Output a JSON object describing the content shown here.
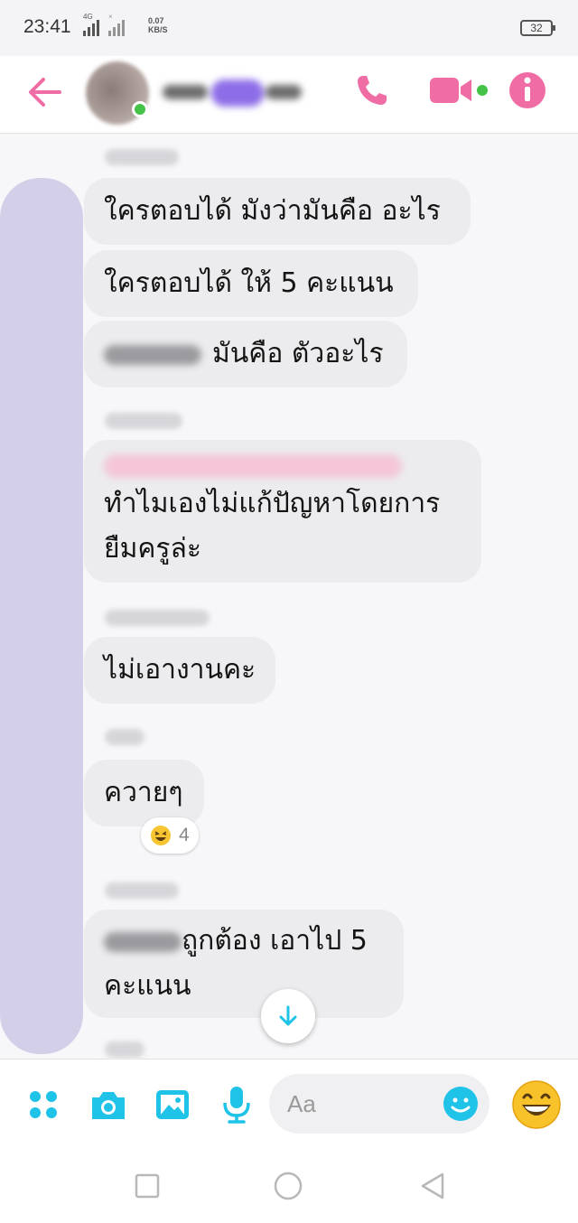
{
  "status_bar": {
    "time": "23:41",
    "network_label": "4G",
    "speed_value": "0.07",
    "speed_unit": "KB/S",
    "battery": "32"
  },
  "header": {
    "back_icon": "arrow-left-icon",
    "call_icon": "phone-icon",
    "video_icon": "video-camera-icon",
    "info_icon": "info-icon",
    "accent_color": "#f06ca4",
    "online_color": "#45c349"
  },
  "messages": {
    "m1": "ใครตอบได้ มังว่ามันคือ อะไร",
    "m2": "ใครตอบได้ ให้ 5 คะแนน",
    "m3": "มันคือ ตัวอะไร",
    "m4_line1": "ทำไมเองไม่แก้ปัญหาโดยการ",
    "m4_line2": "ยืมครูล่ะ",
    "m5": "ไม่เอางานคะ",
    "m6": "ควายๆ",
    "m7_line1": "ถูกต้อง เอาไป 5",
    "m7_line2": "คะแนน"
  },
  "reaction": {
    "emoji": "laughing-face-icon",
    "count": "4"
  },
  "composer": {
    "placeholder": "Aa",
    "icons": [
      "menu-dots-icon",
      "camera-icon",
      "image-icon",
      "microphone-icon",
      "smiley-icon",
      "grinning-emoji-icon"
    ],
    "accent_color": "#1fc3e8"
  },
  "navbar": {
    "icons": [
      "square-recents-icon",
      "circle-home-icon",
      "triangle-back-icon"
    ]
  }
}
